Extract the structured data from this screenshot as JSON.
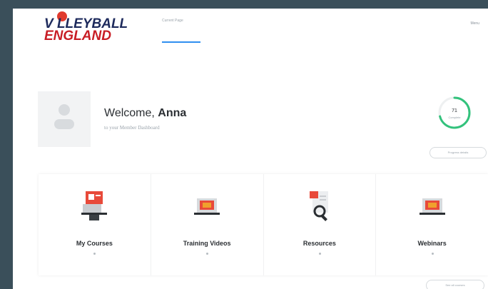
{
  "header": {
    "logo_line1": "V LLEYBALL",
    "logo_line2": "ENGLAND",
    "nav_item": "Current Page",
    "nav_right": "Menu"
  },
  "welcome": {
    "greeting": "Welcome, ",
    "name": "Anna",
    "subtitle": "to your Member Dashboard"
  },
  "progress": {
    "value_label": "71",
    "caption": "Complete",
    "fraction": 0.71,
    "button_label": "Progress details"
  },
  "cards": [
    {
      "label": "My Courses",
      "icon": "courses-icon",
      "count": "0"
    },
    {
      "label": "Training Videos",
      "icon": "video-laptop-icon",
      "count": "0"
    },
    {
      "label": "Resources",
      "icon": "resources-search-icon",
      "count": "0"
    },
    {
      "label": "Webinars",
      "icon": "webinar-laptop-icon",
      "count": "0"
    }
  ],
  "bottom_button": "See all courses",
  "colors": {
    "accent_blue": "#2f8ff0",
    "progress_green": "#33c27c",
    "brand_navy": "#1d2a5c",
    "brand_red": "#c81d25"
  }
}
